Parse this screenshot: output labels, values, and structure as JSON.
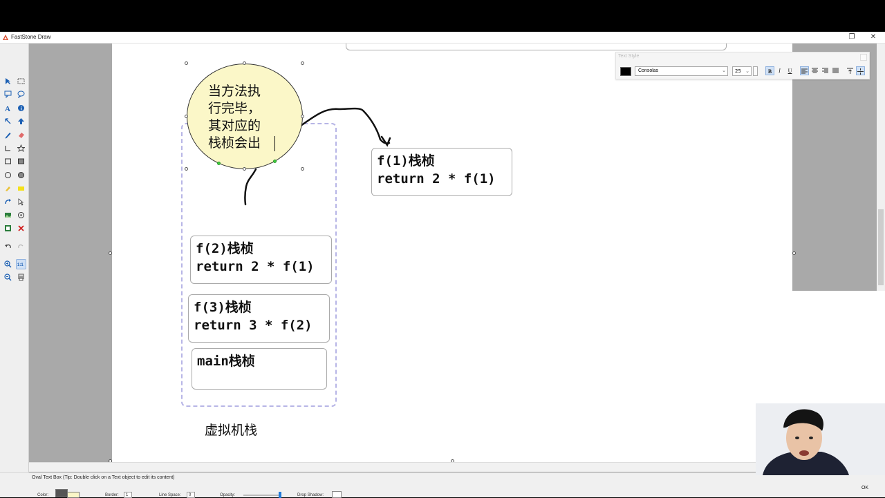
{
  "window": {
    "title": "FastStone Draw",
    "restore_glyph": "❐",
    "close_glyph": "✕"
  },
  "text_style_bar": {
    "title": "Text Style",
    "color": "#000000",
    "font": "Consolas",
    "size": "25",
    "bold": "B",
    "italic": "I",
    "underline": "U"
  },
  "diagram": {
    "oval_text": "当方法执\n行完毕，\n其对应的\n栈桢会出",
    "frame_f1": "f(1)栈桢\nreturn 2 * f(1)",
    "frame_f2": "f(2)栈桢\nreturn 2 * f(1)",
    "frame_f3": "f(3)栈桢\nreturn 3 * f(2)",
    "frame_main": "main栈桢",
    "stack_caption": "虚拟机栈"
  },
  "statusbar": {
    "tip": "Oval Text Box (Tip: Double click on a Text object to edit its content)",
    "color_label": "Color:",
    "border_label": "Border:",
    "border_value": "1",
    "line_space_label": "Line Space:",
    "line_space_value": "0",
    "opacity_label": "Opacity:",
    "opacity_value": 1.0,
    "drop_shadow_label": "Drop Shadow:",
    "ok_label": "OK"
  },
  "colors": {
    "oval_fill": "#fbf7c8",
    "dashed_border": "#b7b5e6",
    "workspace": "#a9a9a9"
  },
  "icons": [
    "select-arrow-icon",
    "rect-select-icon",
    "speech-bubble-icon",
    "speech-bubble-round-icon",
    "text-icon",
    "info-icon",
    "arrow-icon",
    "thick-arrow-icon",
    "pen-icon",
    "eraser-icon",
    "line-icon",
    "star-icon",
    "rectangle-icon",
    "filled-rectangle-icon",
    "ellipse-icon",
    "filled-ellipse-icon",
    "highlighter-icon",
    "yellow-fill-icon",
    "curve-arrow-icon",
    "pointer-icon",
    "image-icon",
    "target-icon",
    "picture-icon",
    "delete-icon",
    "undo-icon",
    "redo-icon",
    "zoom-in-icon",
    "actual-size-icon",
    "zoom-out-icon",
    "print-icon"
  ]
}
